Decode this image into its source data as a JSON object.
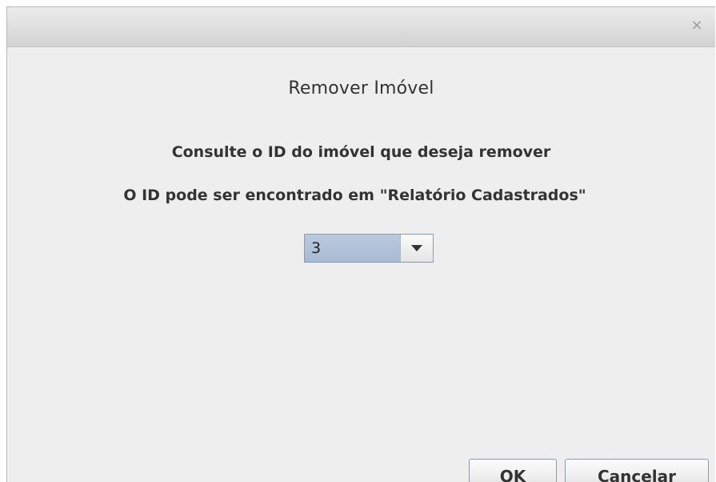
{
  "dialog": {
    "close_symbol": "×",
    "heading": "Remover Imóvel",
    "instruction_1": "Consulte o ID do imóvel que deseja remover",
    "instruction_2": "O ID pode ser encontrado em \"Relatório Cadastrados\"",
    "id_select": {
      "selected_value": "3",
      "arrow_icon": "triangle-down-icon"
    },
    "buttons": {
      "ok_label": "OK",
      "cancel_label": "Cancelar"
    }
  }
}
